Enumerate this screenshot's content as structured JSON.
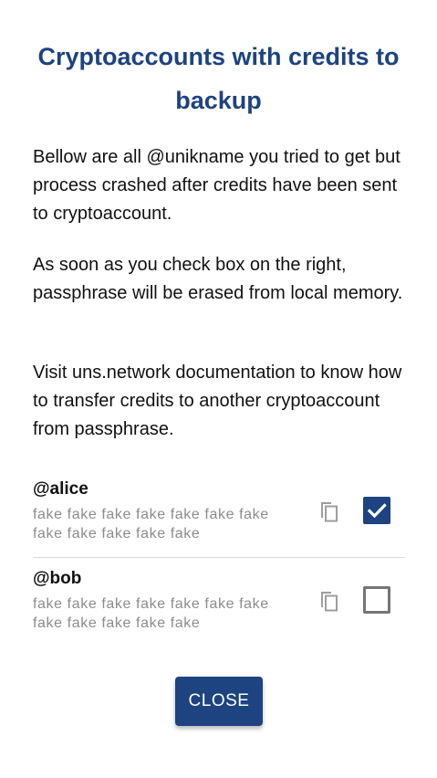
{
  "dialog": {
    "title": "Cryptoaccounts with credits to backup",
    "paragraphs": [
      "Bellow are all @unikname you tried to get but process crashed after credits have been sent to cryptoaccount.",
      "As soon as you check box on the right, passphrase will be erased from local memory.",
      "Visit uns.network documentation to know how to transfer credits to another cryptoaccount from passphrase."
    ],
    "accounts": [
      {
        "name": "@alice",
        "passphrase": "fake fake fake fake fake fake fake fake fake fake fake fake",
        "checked": true
      },
      {
        "name": "@bob",
        "passphrase": "fake fake fake fake fake fake fake fake fake fake fake fake",
        "checked": false
      }
    ],
    "close_label": "CLOSE"
  },
  "colors": {
    "accent": "#1d4380",
    "muted_text": "#8c8c8c",
    "icon_gray": "#9e9e9e",
    "divider": "#d9d9d9"
  },
  "icons": {
    "copy": "copy-icon",
    "check": "check-icon"
  }
}
